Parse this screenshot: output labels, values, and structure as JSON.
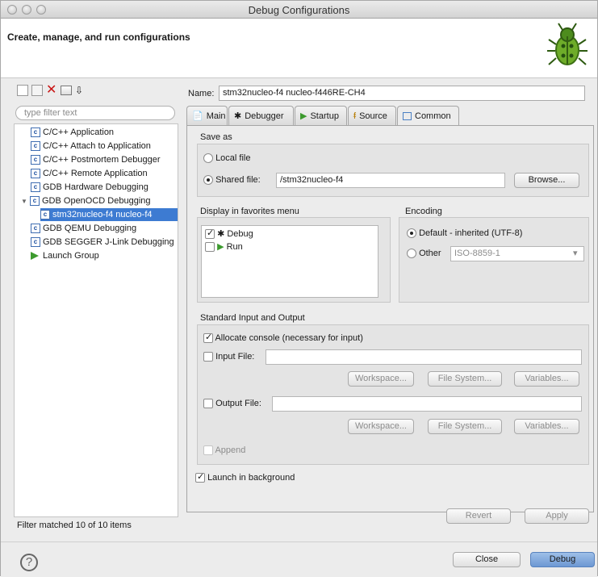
{
  "window": {
    "title": "Debug Configurations"
  },
  "header": {
    "title": "Create, manage, and run configurations",
    "icon": "bug-icon"
  },
  "left": {
    "filter_placeholder": "type filter text",
    "items": [
      {
        "label": "C/C++ Application",
        "icon": "c-icon"
      },
      {
        "label": "C/C++ Attach to Application",
        "icon": "c-icon"
      },
      {
        "label": "C/C++ Postmortem Debugger",
        "icon": "c-icon"
      },
      {
        "label": "C/C++ Remote Application",
        "icon": "c-icon"
      },
      {
        "label": "GDB Hardware Debugging",
        "icon": "c-icon"
      },
      {
        "label": "GDB OpenOCD Debugging",
        "icon": "c-icon",
        "expanded": true
      },
      {
        "label": "stm32nucleo-f4 nucleo-f4",
        "icon": "c-icon",
        "selected": true
      },
      {
        "label": "GDB QEMU Debugging",
        "icon": "c-icon"
      },
      {
        "label": "GDB SEGGER J-Link Debugging",
        "icon": "c-icon"
      },
      {
        "label": "Launch Group",
        "icon": "launch-group-icon"
      }
    ],
    "status": "Filter matched 10 of 10 items"
  },
  "main": {
    "name_label": "Name:",
    "name_value": "stm32nucleo-f4 nucleo-f446RE-CH4",
    "tabs": [
      {
        "label": "Main",
        "icon": "main-tab-icon"
      },
      {
        "label": "Debugger",
        "icon": "debugger-tab-icon"
      },
      {
        "label": "Startup",
        "icon": "startup-tab-icon"
      },
      {
        "label": "Source",
        "icon": "source-tab-icon"
      },
      {
        "label": "Common",
        "icon": "common-tab-icon",
        "active": true
      }
    ],
    "save_as": {
      "title": "Save as",
      "local_file": "Local file",
      "shared_file": "Shared file:",
      "shared_path": "/stm32nucleo-f4",
      "browse": "Browse..."
    },
    "favorites": {
      "title": "Display in favorites menu",
      "items": [
        {
          "label": "Debug",
          "checked": true,
          "icon": "debug-icon"
        },
        {
          "label": "Run",
          "checked": false,
          "icon": "run-icon"
        }
      ]
    },
    "encoding": {
      "title": "Encoding",
      "default_option": "Default - inherited (UTF-8)",
      "other_option": "Other",
      "other_value": "ISO-8859-1"
    },
    "standard_io": {
      "title": "Standard Input and Output",
      "allocate": "Allocate console (necessary for input)",
      "input_file": "Input File:",
      "output_file": "Output File:",
      "workspace": "Workspace...",
      "file_system": "File System...",
      "variables": "Variables...",
      "append": "Append"
    },
    "launch_background": "Launch in background",
    "revert": "Revert",
    "apply": "Apply"
  },
  "footer": {
    "close": "Close",
    "debug": "Debug",
    "help": "?"
  }
}
